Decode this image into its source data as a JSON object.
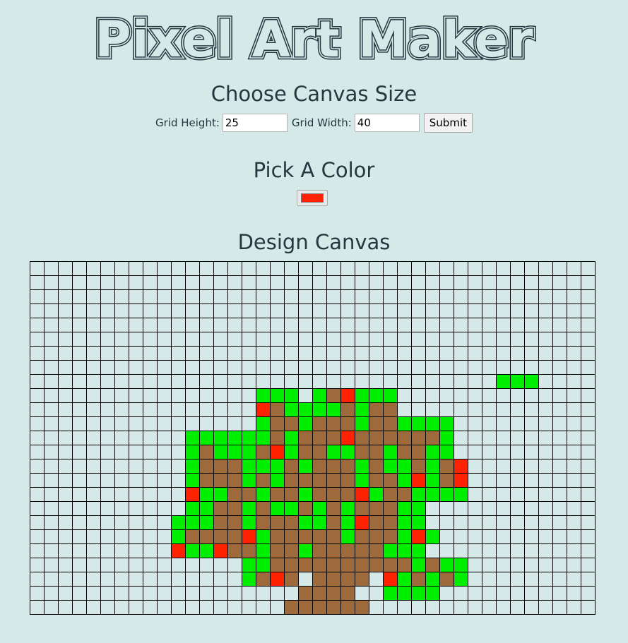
{
  "app": {
    "title": "Pixel Art Maker",
    "title_color": "#21393f"
  },
  "size_section": {
    "heading": "Choose Canvas Size",
    "height_label": "Grid Height:",
    "height_value": "25",
    "width_label": "Grid Width:",
    "width_value": "40",
    "submit_label": "Submit"
  },
  "color_section": {
    "heading": "Pick A Color",
    "selected_color": "#ff2200"
  },
  "canvas_section": {
    "heading": "Design Canvas",
    "rows": 25,
    "cols": 40,
    "palette": {
      "G": "#00ee00",
      "B": "#9e6a3c",
      "R": "#ff2200",
      "E": "#d5e9e9"
    },
    "pixels": [
      "........................................",
      "........................................",
      "........................................",
      "........................................",
      "........................................",
      "........................................",
      "........................................",
      "........................................",
      "………….....................GGG...............",
      "................GGG.GBRGGG..............",
      "................RBGGGGBGBB..............",
      "................GBBGBBBGBBGGGG..........",
      "...........GGGGGGBGBBBRBBBBBBG..........",
      "...........GBGGGBRGBBGGBBGBBGG..........",
      "...........GBBBGGGBGBBBGBGGBGBR.........",
      "...........GBBBGBGBBBBBGBBGRGBR.........",
      "...........RGGBBGBBGBBBRGBBGGGG.........",
      "...........GGBBGBGGBGBGBBBGG............",
      "..........GGGBBGBBBGGBGRBBGG............",
      "..........GBBBBRGBBBBBGBBBGRG...........",
      "..........RGGRBBGBBGBBBBBGGG............",
      "...............GGBBBBBBBBBBGBGG.........",
      "...............GBRBEBBBBERGBGBG.........",
      "...................BBBB..GGGG...........",
      "..................BBBBBB................"
    ]
  }
}
